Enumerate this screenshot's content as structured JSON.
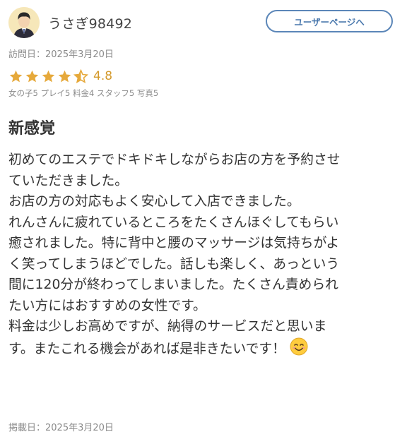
{
  "user": {
    "name": "うさぎ98492",
    "button_label": "ユーザーページへ"
  },
  "visit_date": "訪問日：2025年3月20日",
  "rating": {
    "value": "4.8",
    "stars": 4.5,
    "star_color": "#e6a93b",
    "sub_scores": "女の子5 プレイ5 料金4 スタッフ5 写真5"
  },
  "review": {
    "title": "新感覚",
    "lines": [
      "初めてのエステでドキドキしながらお店の方を予約させ",
      "ていただきました。",
      "お店の方の対応もよく安心して入店できました。",
      "れんさんに疲れているところをたくさんほぐしてもらい",
      "癒されました。特に背中と腰のマッサージは気持ちがよ",
      "く笑ってしまうほどでした。話しも楽しく、あっという",
      "間に120分が終わってしまいました。たくさん責められ",
      "たい方にはおすすめの女性です。",
      "料金は少しお高めですが、納得のサービスだと思いま",
      "す。またこれる機会があれば是非きたいです！"
    ],
    "emoji_icon": "smiling-face-icon"
  },
  "posted_date": "掲載日：2025年3月20日",
  "colors": {
    "accent": "#4a78ad",
    "muted_text": "#8a8a8a"
  }
}
